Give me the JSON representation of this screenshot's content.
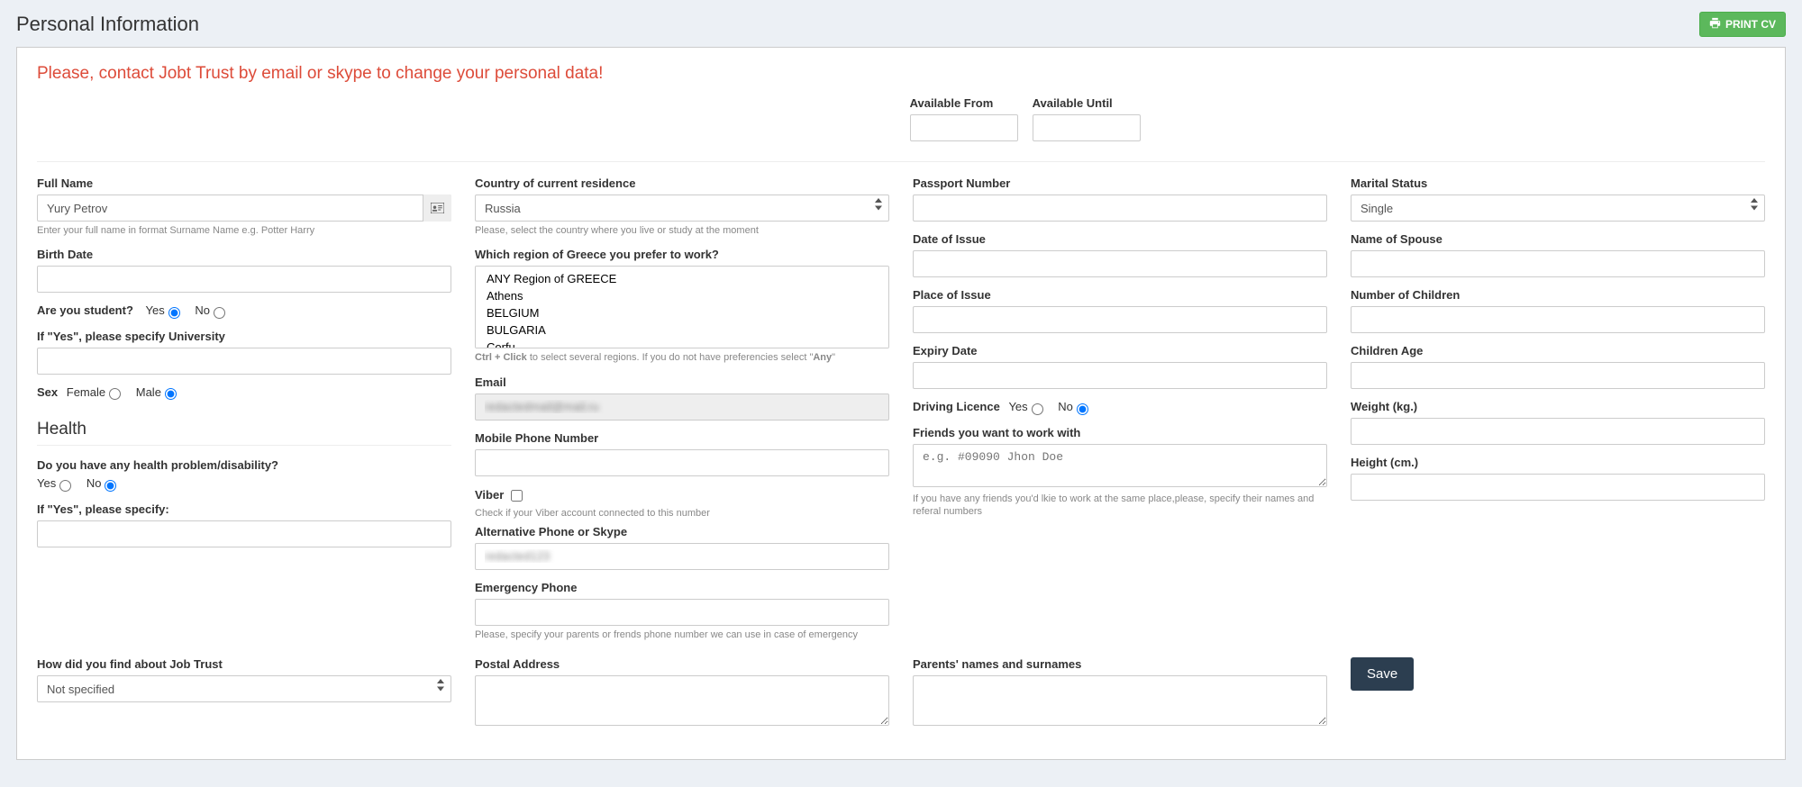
{
  "page": {
    "title": "Personal Information",
    "print_label": "PRINT CV"
  },
  "warning": "Please, contact Jobt Trust by email or skype to change your personal data!",
  "avail": {
    "from_label": "Available From",
    "until_label": "Available Until",
    "from_value": "",
    "until_value": ""
  },
  "col1": {
    "full_name_label": "Full Name",
    "full_name_value": "Yury Petrov",
    "full_name_help": "Enter your full name in format Surname Name e.g. Potter Harry",
    "birth_label": "Birth Date",
    "birth_value": "",
    "student_label": "Are you student?",
    "yes": "Yes",
    "no": "No",
    "university_label": "If \"Yes\", please specify University",
    "university_value": "",
    "sex_label": "Sex",
    "female": "Female",
    "male": "Male",
    "health_heading": "Health",
    "health_q_label": "Do you have any health problem/disability?",
    "health_specify_label": "If \"Yes\", please specify:",
    "health_specify_value": "",
    "find_label": "How did you find about Job Trust",
    "find_selected": "Not specified"
  },
  "col2": {
    "country_label": "Country of current residence",
    "country_selected": "Russia",
    "country_help": "Please, select the country where you live or study at the moment",
    "region_label": "Which region of Greece you prefer to work?",
    "region_options": [
      "ANY Region of GREECE",
      "Athens",
      "BELGIUM",
      "BULGARIA",
      "Corfu"
    ],
    "region_help_a": "Ctrl + Click",
    "region_help_b": " to select several regions. If you do not have preferencies select \"",
    "region_help_c": "Any",
    "region_help_d": "\"",
    "email_label": "Email",
    "email_value": "redactedmail@mail.ru",
    "mobile_label": "Mobile Phone Number",
    "mobile_value": "",
    "viber_label": "Viber",
    "viber_help": "Check if your Viber account connected to this number",
    "alt_label": "Alternative Phone or Skype",
    "alt_value": "redacted123",
    "emerg_label": "Emergency Phone",
    "emerg_value": "",
    "emerg_help": "Please, specify your parents or frends phone number we can use in case of emergency",
    "postal_label": "Postal Address",
    "postal_value": ""
  },
  "col3": {
    "passport_label": "Passport Number",
    "passport_value": "",
    "doi_label": "Date of Issue",
    "doi_value": "",
    "poi_label": "Place of Issue",
    "poi_value": "",
    "expiry_label": "Expiry Date",
    "expiry_value": "",
    "driving_label": "Driving Licence",
    "friends_label": "Friends you want to work with",
    "friends_placeholder": "e.g. #09090 Jhon Doe",
    "friends_value": "",
    "friends_help": "If you have any friends you'd lkie to work at the same place,please, specify their names and referal numbers",
    "parents_label": "Parents' names and surnames",
    "parents_value": ""
  },
  "col4": {
    "marital_label": "Marital Status",
    "marital_selected": "Single",
    "spouse_label": "Name of Spouse",
    "spouse_value": "",
    "children_num_label": "Number of Children",
    "children_num_value": "",
    "children_age_label": "Children Age",
    "children_age_value": "",
    "weight_label": "Weight (kg.)",
    "weight_value": "",
    "height_label": "Height (cm.)",
    "height_value": "",
    "save_label": "Save"
  }
}
